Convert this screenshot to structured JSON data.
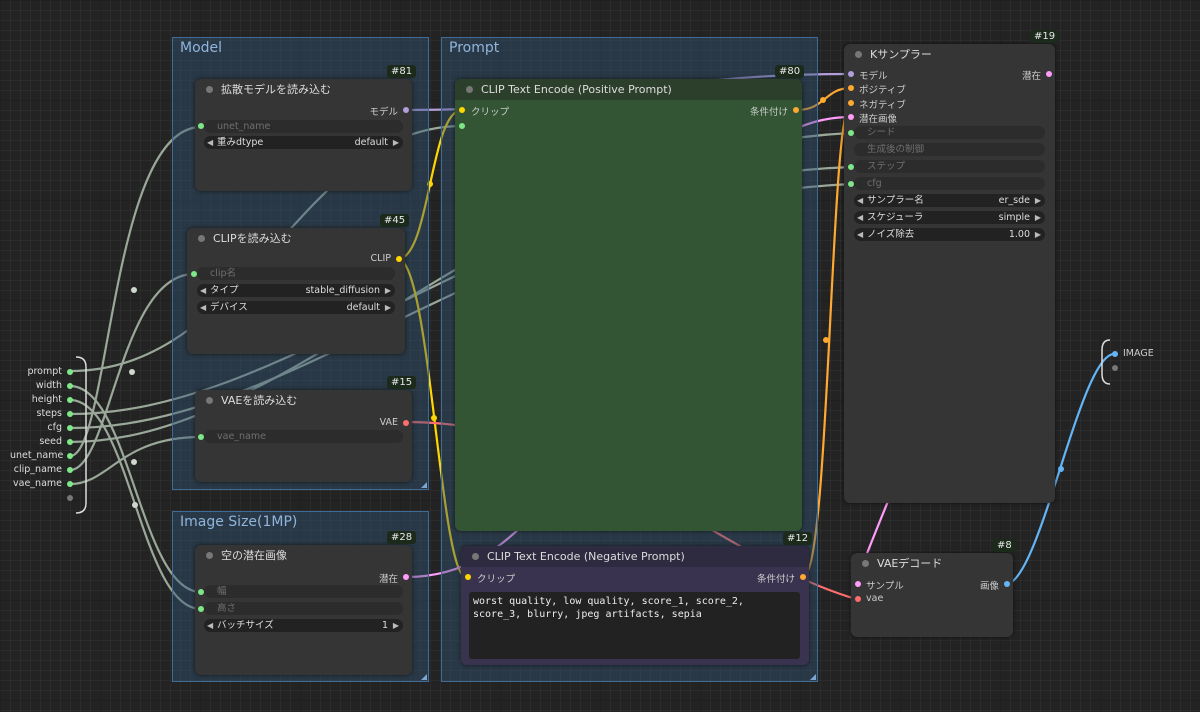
{
  "groups": {
    "model": "Model",
    "prompt": "Prompt",
    "image_size": "Image Size(1MP)"
  },
  "nodes": {
    "unet_loader": {
      "id": "#81",
      "title": "拡散モデルを読み込む",
      "output": "モデル",
      "unet_name": "unet_name",
      "dtype_label": "重みdtype",
      "dtype_value": "default"
    },
    "clip_loader": {
      "id": "#45",
      "title": "CLIPを読み込む",
      "output": "CLIP",
      "clip_name": "clip名",
      "type_label": "タイプ",
      "type_value": "stable_diffusion",
      "device_label": "デバイス",
      "device_value": "default"
    },
    "vae_loader": {
      "id": "#15",
      "title": "VAEを読み込む",
      "output": "VAE",
      "vae_name": "vae_name"
    },
    "empty_latent": {
      "id": "#28",
      "title": "空の潜在画像",
      "output": "潜在",
      "width": "幅",
      "height": "高さ",
      "batch_label": "バッチサイズ",
      "batch_value": "1"
    },
    "clip_pos": {
      "id": "#80",
      "title": "CLIP Text Encode (Positive Prompt)",
      "input": "クリップ",
      "output": "条件付け"
    },
    "clip_neg": {
      "id": "#12",
      "title": "CLIP Text Encode (Negative Prompt)",
      "input": "クリップ",
      "output": "条件付け",
      "text": "worst quality, low quality, score_1, score_2, score_3, blurry, jpeg artifacts, sepia"
    },
    "ksampler": {
      "id": "#19",
      "title": "Kサンプラー",
      "inputs": [
        "モデル",
        "ポジティブ",
        "ネガティブ",
        "潜在画像"
      ],
      "output": "潜在",
      "seed": "シード",
      "control": "生成後の制御",
      "steps": "ステップ",
      "cfg": "cfg",
      "sampler_label": "サンプラー名",
      "sampler_value": "er_sde",
      "scheduler_label": "スケジューラ",
      "scheduler_value": "simple",
      "denoise_label": "ノイズ除去",
      "denoise_value": "1.00"
    },
    "vae_decode": {
      "id": "#8",
      "title": "VAEデコード",
      "input_samples": "サンプル",
      "input_vae": "vae",
      "output": "画像"
    }
  },
  "subgraph_inputs": [
    "prompt",
    "width",
    "height",
    "steps",
    "cfg",
    "seed",
    "unet_name",
    "clip_name",
    "vae_name"
  ],
  "subgraph_output": "IMAGE",
  "colors": {
    "model": "#b39ddb",
    "clip": "#ffd600",
    "conditioning": "#ffa931",
    "latent": "#ff9cf9",
    "vae": "#ff6e6e",
    "image": "#64b5f6",
    "input": "#7ee787",
    "link_gray": "#9aa89a"
  }
}
